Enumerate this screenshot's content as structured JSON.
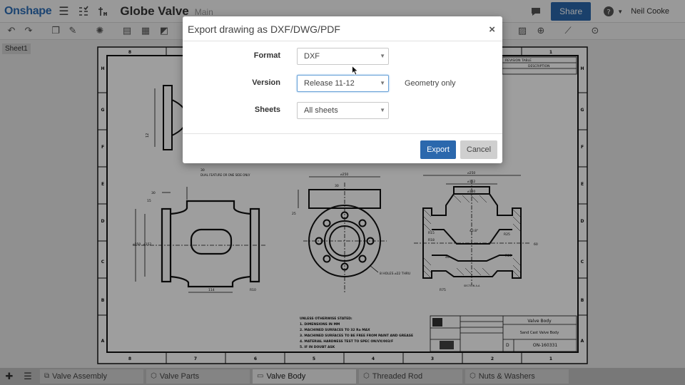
{
  "app": {
    "logo": "Onshape",
    "document_title": "Globe Valve",
    "branch": "Main",
    "share_label": "Share",
    "help_icon": "help-icon",
    "user_name": "Neil Cooke"
  },
  "sheets": {
    "current": "Sheet1"
  },
  "dialog": {
    "title": "Export drawing as DXF/DWG/PDF",
    "close_symbol": "×",
    "format_label": "Format",
    "format_value": "DXF",
    "version_label": "Version",
    "version_value": "Release 11-12",
    "version_note": "Geometry only",
    "sheets_label": "Sheets",
    "sheets_value": "All sheets",
    "export_label": "Export",
    "cancel_label": "Cancel"
  },
  "tabs": [
    {
      "label": "Valve Assembly",
      "icon": "assembly-icon",
      "active": false
    },
    {
      "label": "Valve Parts",
      "icon": "part-studio-icon",
      "active": false
    },
    {
      "label": "Valve Body",
      "icon": "drawing-icon",
      "active": true
    },
    {
      "label": "Threaded Rod",
      "icon": "part-studio-icon",
      "active": false
    },
    {
      "label": "Nuts & Washers",
      "icon": "part-studio-icon",
      "active": false
    }
  ],
  "drawing": {
    "zones_top": [
      "8",
      "7",
      "6",
      "5",
      "4",
      "3",
      "2",
      "1"
    ],
    "zones_side": [
      "H",
      "G",
      "F",
      "E",
      "D",
      "C",
      "B",
      "A"
    ],
    "title_block_name": "Valve Body",
    "title_block_desc": "Sand Cast Valve Body",
    "title_block_number": "ON-160331",
    "title_block_size": "D",
    "revision_table_title": "REVISION TABLE",
    "revision_table_desc": "DESCRIPTION",
    "notes_title": "UNLESS OTHERWISE STATED:",
    "notes": [
      "1. DIMENSIONS IN MM",
      "2. MACHINED SURFACES TO 32 Ra MAX",
      "3. MACHINED SURFACES TO BE FREE FROM PAINT AND GREASE",
      "4. MATERIAL HARDNESS TEST TO SPEC ON/VX/003/F",
      "5. IF IN DOUBT ASK"
    ],
    "dims": {
      "d250": "⌀250",
      "d152": "⌀152",
      "d120": "⌀120",
      "r10": "R10",
      "r25": "R25",
      "r15": "R15",
      "r18": "R18",
      "r75": "R75",
      "d8": "8 HOLES ⌀22 THRU",
      "d114": "114",
      "d25": "25",
      "d30": "30",
      "d15": "15",
      "d12": "12",
      "dual": "DUAL FEATURE OR ONE SIDE ONLY",
      "r20": "R20",
      "d40": "40",
      "d60": "60",
      "a438": "43.8°",
      "sec": "SECTION A-A"
    }
  }
}
